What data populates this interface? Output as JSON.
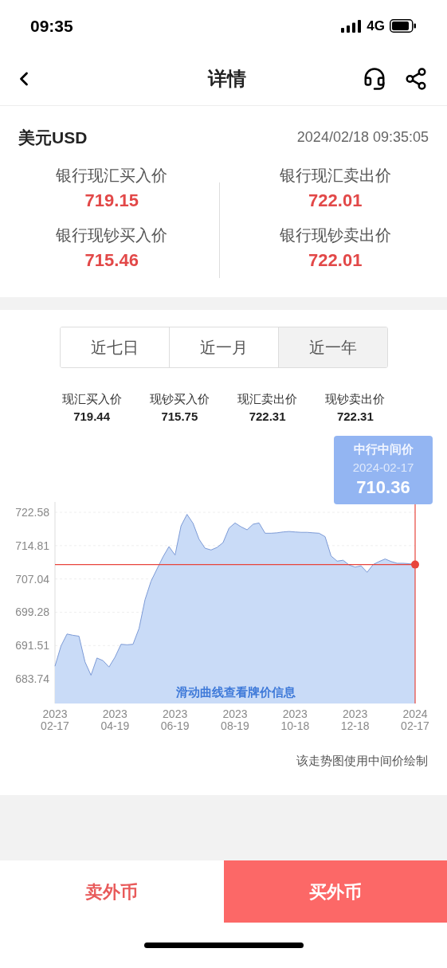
{
  "status_bar": {
    "time": "09:35",
    "network": "4G"
  },
  "header": {
    "title": "详情"
  },
  "currency": {
    "name": "美元USD",
    "timestamp": "2024/02/18 09:35:05",
    "prices": [
      {
        "label": "银行现汇买入价",
        "value": "719.15"
      },
      {
        "label": "银行现汇卖出价",
        "value": "722.01"
      },
      {
        "label": "银行现钞买入价",
        "value": "715.46"
      },
      {
        "label": "银行现钞卖出价",
        "value": "722.01"
      }
    ]
  },
  "range_tabs": [
    {
      "label": "近七日",
      "selected": false
    },
    {
      "label": "近一月",
      "selected": false
    },
    {
      "label": "近一年",
      "selected": true
    }
  ],
  "summary": [
    {
      "label": "现汇买入价",
      "value": "719.44"
    },
    {
      "label": "现钞买入价",
      "value": "715.75"
    },
    {
      "label": "现汇卖出价",
      "value": "722.31"
    },
    {
      "label": "现钞卖出价",
      "value": "722.31"
    }
  ],
  "chart": {
    "tooltip": {
      "date": "2024-02-17",
      "value": "710.36"
    },
    "hint": "滑动曲线查看牌价信息",
    "chart_data": {
      "type": "area",
      "categories": [
        "2023 02-17",
        null,
        null,
        null,
        null,
        null,
        null,
        null,
        null,
        null,
        "2023 04-19",
        null,
        null,
        null,
        null,
        null,
        null,
        null,
        null,
        null,
        "2023 06-19",
        null,
        null,
        null,
        null,
        null,
        null,
        null,
        null,
        null,
        "2023 08-19",
        null,
        null,
        null,
        null,
        null,
        null,
        null,
        null,
        null,
        "2023 10-18",
        null,
        null,
        null,
        null,
        null,
        null,
        null,
        null,
        null,
        "2023 12-18",
        null,
        null,
        null,
        null,
        null,
        null,
        null,
        null,
        null,
        "2024 02-17"
      ],
      "series": [
        {
          "name": "中行中间价",
          "color": "#c9dbf7",
          "values": [
            686.7,
            691.4,
            694.2,
            693.9,
            693.7,
            687.7,
            684.6,
            688.6,
            688.0,
            686.5,
            688.8,
            691.8,
            691.7,
            691.8,
            695.5,
            702.2,
            706.5,
            709.4,
            712.2,
            714.6,
            712.6,
            719.4,
            722.1,
            720.0,
            716.3,
            714.2,
            713.8,
            714.4,
            715.5,
            718.9,
            720.1,
            719.2,
            718.5,
            719.8,
            720.1,
            717.7,
            717.7,
            717.8,
            718.0,
            718.1,
            718.0,
            717.9,
            717.9,
            717.8,
            717.7,
            716.9,
            712.4,
            711.2,
            711.4,
            710.3,
            709.8,
            710.1,
            708.6,
            710.4,
            711.1,
            711.7,
            711.1,
            710.7,
            710.7,
            710.6,
            710.4
          ]
        }
      ],
      "ylim": [
        678,
        725
      ],
      "grid": true,
      "ref_lines": [
        {
          "axis": "y",
          "value": 710.4,
          "color": "#e8453c"
        }
      ],
      "yticks": [
        {
          "value": 722.58,
          "label": "722.58"
        },
        {
          "value": 714.81,
          "label": "714.81"
        },
        {
          "value": 707.04,
          "label": "707.04"
        },
        {
          "value": 699.28,
          "label": "699.28"
        },
        {
          "value": 691.51,
          "label": "691.51"
        },
        {
          "value": 683.74,
          "label": "683.74"
        }
      ]
    }
  },
  "note": "该走势图使用中间价绘制",
  "actions": [
    {
      "label": "卖外币",
      "kind": "secondary"
    },
    {
      "label": "买外币",
      "kind": "primary"
    }
  ]
}
